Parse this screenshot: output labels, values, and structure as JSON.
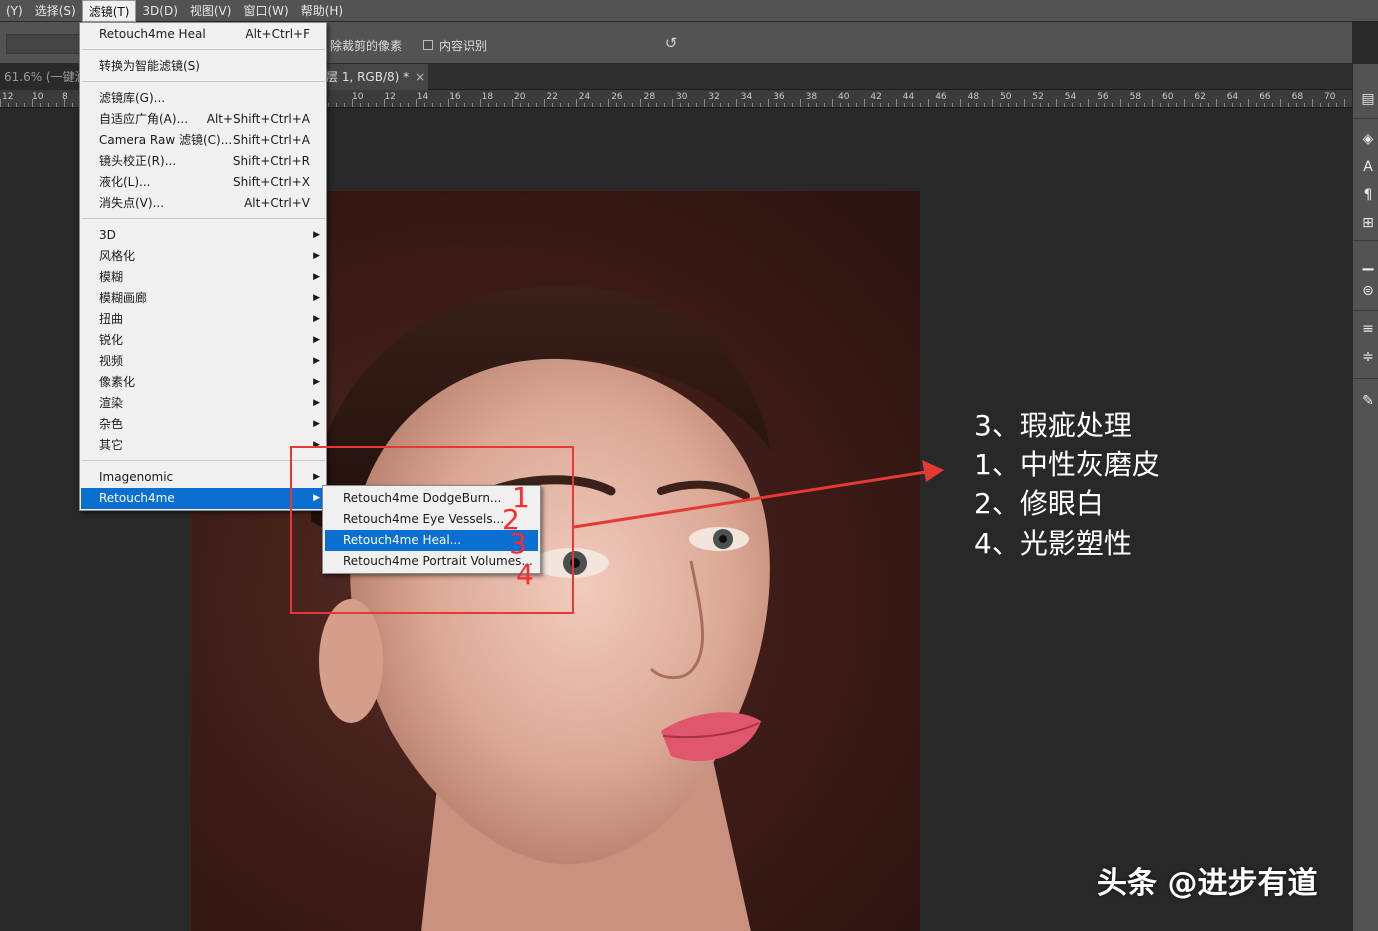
{
  "menubar": {
    "items": [
      "(Y)",
      "选择(S)",
      "滤镜(T)",
      "3D(D)",
      "视图(V)",
      "窗口(W)",
      "帮助(H)"
    ],
    "active_index": 2
  },
  "options_bar": {
    "delete_cropped_label": "除裁剪的像素",
    "content_aware_label": "内容识别",
    "reset_icon": "reset-icon"
  },
  "tabs": {
    "tab1_label": "61.6% (一键润",
    "tab2_label": "层 1, RGB/8) *",
    "close_glyph": "×"
  },
  "ruler": {
    "labels": [
      "12",
      "10",
      "8",
      "10",
      "12",
      "14",
      "16",
      "18",
      "20",
      "22",
      "24",
      "26",
      "28",
      "30",
      "32",
      "34",
      "36",
      "38",
      "40",
      "42",
      "44",
      "46",
      "48",
      "50",
      "52",
      "54",
      "56",
      "58",
      "60",
      "62",
      "64",
      "66",
      "68",
      "70"
    ]
  },
  "filter_menu": {
    "last_filter": {
      "label": "Retouch4me Heal",
      "shortcut": "Alt+Ctrl+F"
    },
    "convert_smart": {
      "label": "转换为智能滤镜(S)"
    },
    "group1": [
      {
        "label": "滤镜库(G)...",
        "shortcut": ""
      },
      {
        "label": "自适应广角(A)...",
        "shortcut": "Alt+Shift+Ctrl+A"
      },
      {
        "label": "Camera Raw 滤镜(C)...",
        "shortcut": "Shift+Ctrl+A"
      },
      {
        "label": "镜头校正(R)...",
        "shortcut": "Shift+Ctrl+R"
      },
      {
        "label": "液化(L)...",
        "shortcut": "Shift+Ctrl+X"
      },
      {
        "label": "消失点(V)...",
        "shortcut": "Alt+Ctrl+V"
      }
    ],
    "group2": [
      "3D",
      "风格化",
      "模糊",
      "模糊画廊",
      "扭曲",
      "锐化",
      "视频",
      "像素化",
      "渲染",
      "杂色",
      "其它"
    ],
    "group3": [
      "Imagenomic",
      "Retouch4me"
    ],
    "arrow_glyph": "▶"
  },
  "submenu": {
    "items": [
      "Retouch4me DodgeBurn...",
      "Retouch4me Eye Vessels...",
      "Retouch4me Heal...",
      "Retouch4me Portrait Volumes..."
    ],
    "highlight_index": 2
  },
  "annotations": {
    "numbers": [
      "1",
      "2",
      "3",
      "4"
    ],
    "notes": [
      "3、瑕疵处理",
      "1、中性灰磨皮",
      "2、修眼白",
      "4、光影塑性"
    ],
    "highlight_color": "#e53935"
  },
  "watermark": "头条 @进步有道",
  "colors": {
    "menu_highlight": "#0a6fd1",
    "annotation_red": "#ff2a2a"
  }
}
